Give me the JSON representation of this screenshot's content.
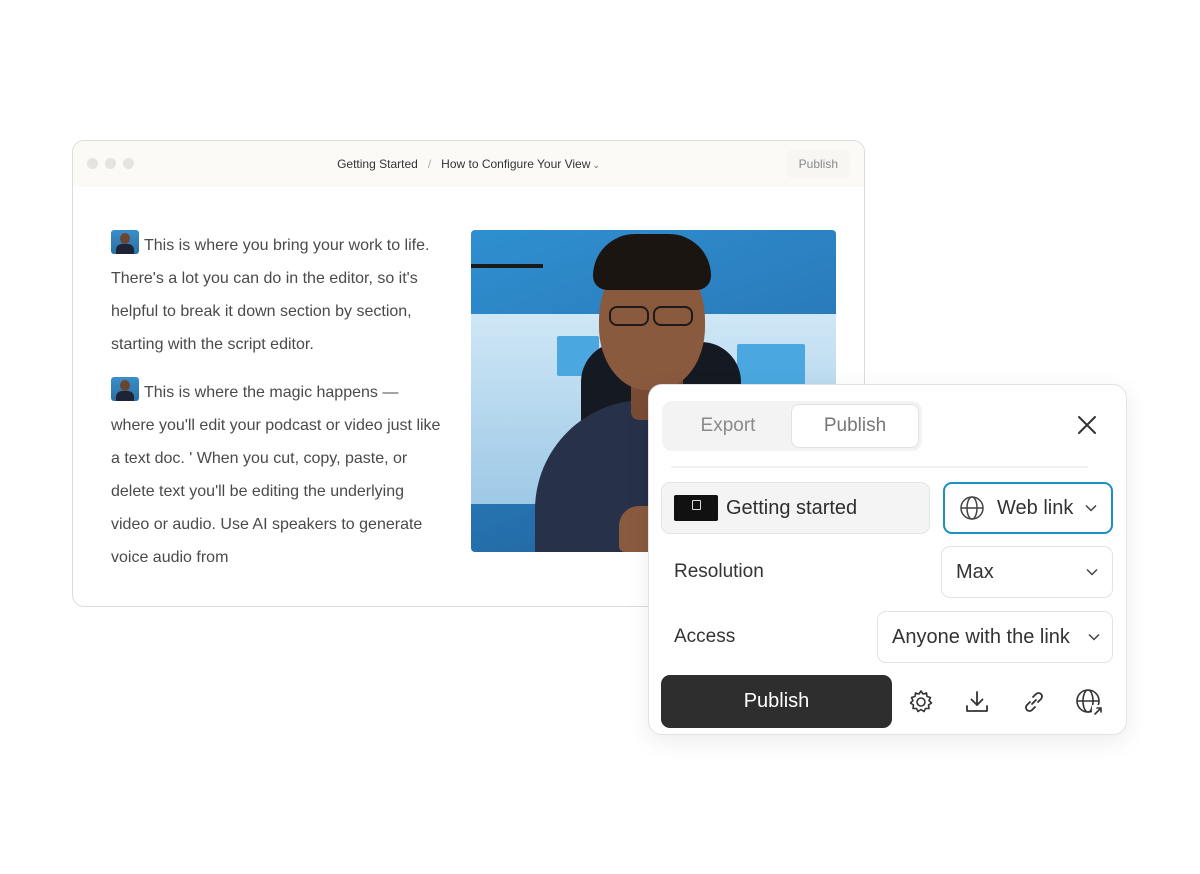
{
  "editor": {
    "breadcrumb": {
      "root": "Getting Started",
      "separator": "/",
      "current": "How to Configure Your View"
    },
    "publish_button": "Publish",
    "script": {
      "paragraphs": [
        "This is where you bring your work to life. There's a lot you can do in the editor, so it's helpful to break it down section by section, starting with the script editor.",
        "This is where the magic happens — where you'll edit your podcast or video just like a text doc. ' When you cut, copy, paste, or delete text you'll be editing the underlying video or audio. Use AI speakers to generate voice audio from"
      ]
    }
  },
  "publish_panel": {
    "tabs": [
      {
        "label": "Export",
        "active": false
      },
      {
        "label": "Publish",
        "active": true
      }
    ],
    "project_name": "Getting started",
    "destination": {
      "icon": "globe-icon",
      "value": "Web link"
    },
    "resolution": {
      "label": "Resolution",
      "value": "Max"
    },
    "access": {
      "label": "Access",
      "value": "Anyone with the link"
    },
    "publish_button": "Publish",
    "actions": [
      "gear-icon",
      "download-icon",
      "link-icon",
      "globe-share-icon"
    ],
    "accent_color": "#1c8fc4"
  }
}
